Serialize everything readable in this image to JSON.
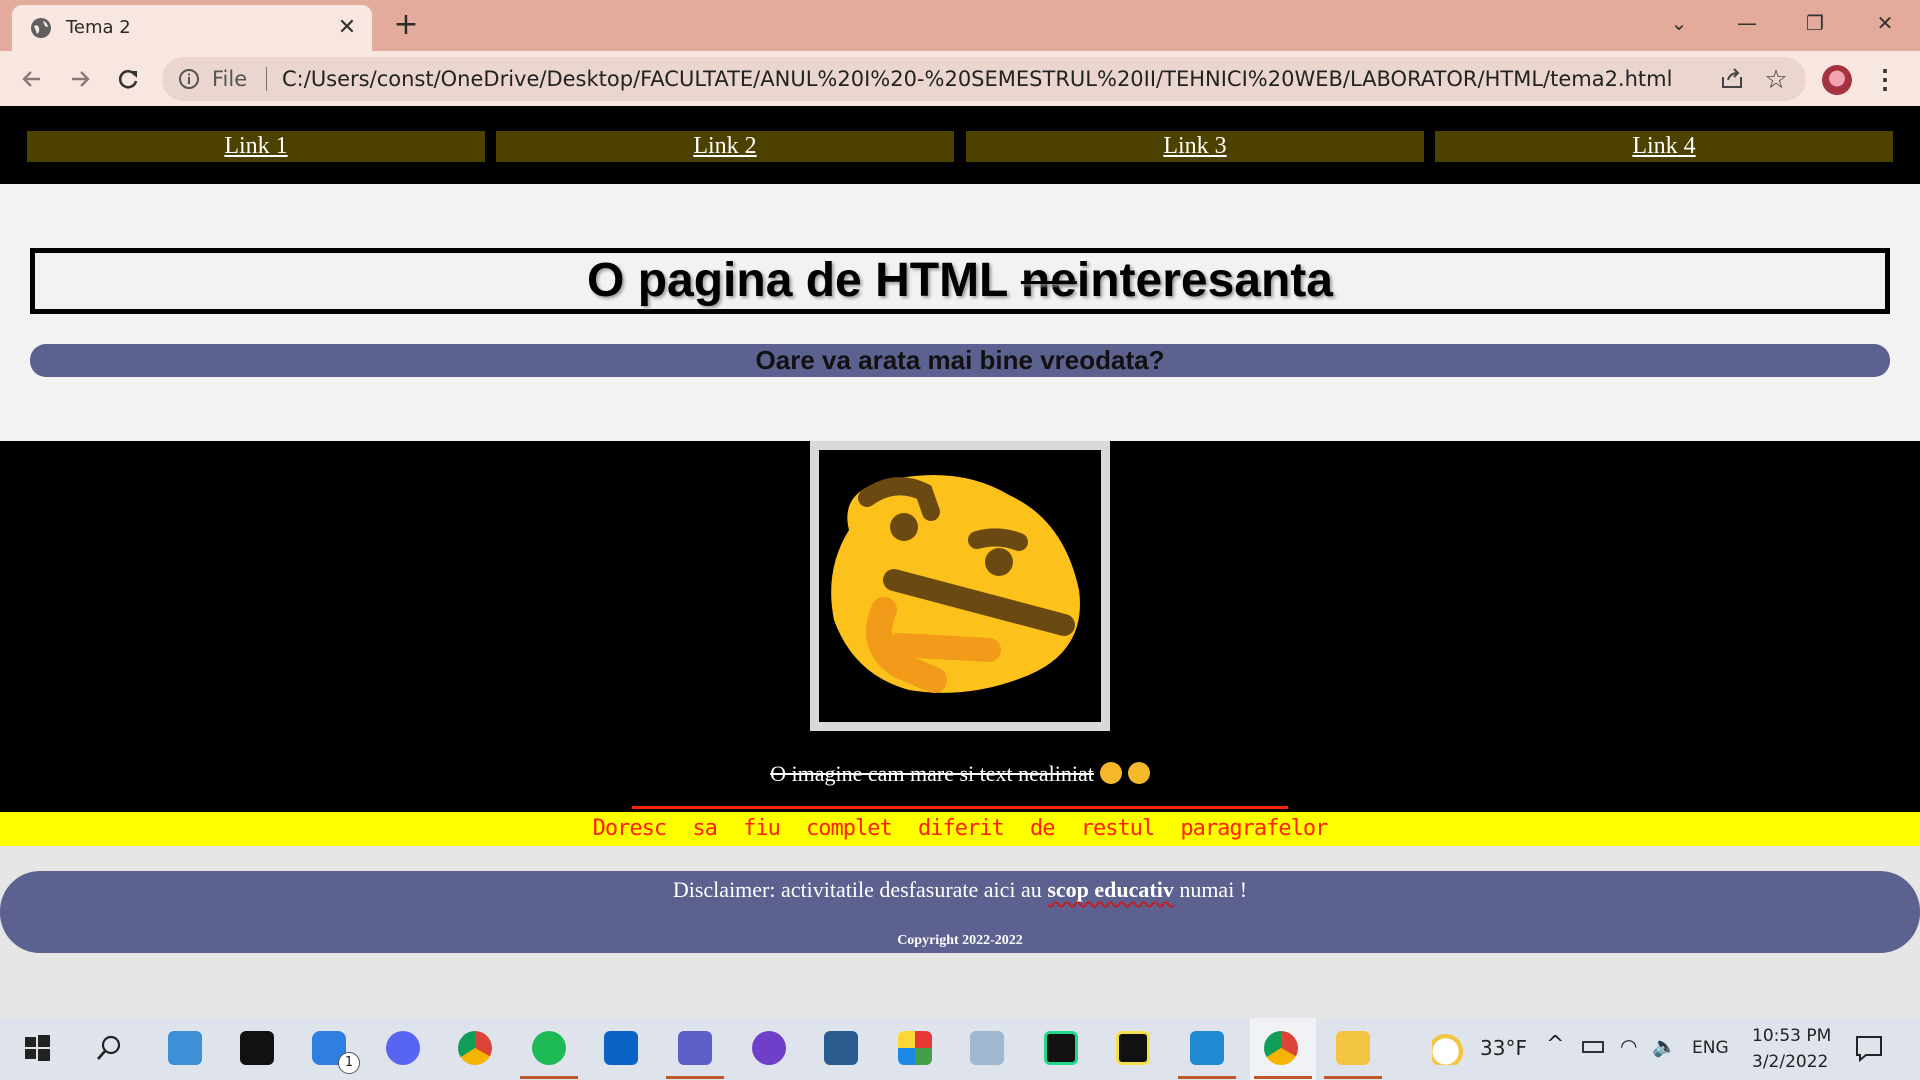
{
  "browser": {
    "tab_title": "Tema 2",
    "tab_close": "✕",
    "new_tab": "+",
    "address_scheme": "File",
    "address_url": "C:/Users/const/OneDrive/Desktop/FACULTATE/ANUL%20I%20-%20SEMESTRUL%20II/TEHNICI%20WEB/LABORATOR/HTML/tema2.html"
  },
  "page": {
    "nav_links": [
      "Link 1",
      "Link 2",
      "Link 3",
      "Link 4"
    ],
    "title_strike": "ne",
    "title_before": "O pagina de HTML ",
    "title_after": "interesanta",
    "subtitle": "Oare va arata mai bine vreodata?",
    "caption": "O imagine cam mare si text nealiniat",
    "different_paragraph": "Doresc sa fiu complet diferit de restul paragrafelor",
    "disclaimer_before": "Disclaimer: activitatile desfasurate aici au ",
    "disclaimer_bold": "scop educativ",
    "disclaimer_after": " numai !",
    "copyright": "Copyright 2022-2022",
    "image_icon": "thinking-face-icon",
    "colors": {
      "nav_link_bg": "#4d4100",
      "subtitle_bar": "#5d6190",
      "yellow_band": "#ffff00",
      "different_text": "#ff2200"
    }
  },
  "taskbar": {
    "weather": "33°F",
    "language": "ENG",
    "time": "10:53 PM",
    "date": "3/2/2022",
    "todo_badge": "1"
  }
}
